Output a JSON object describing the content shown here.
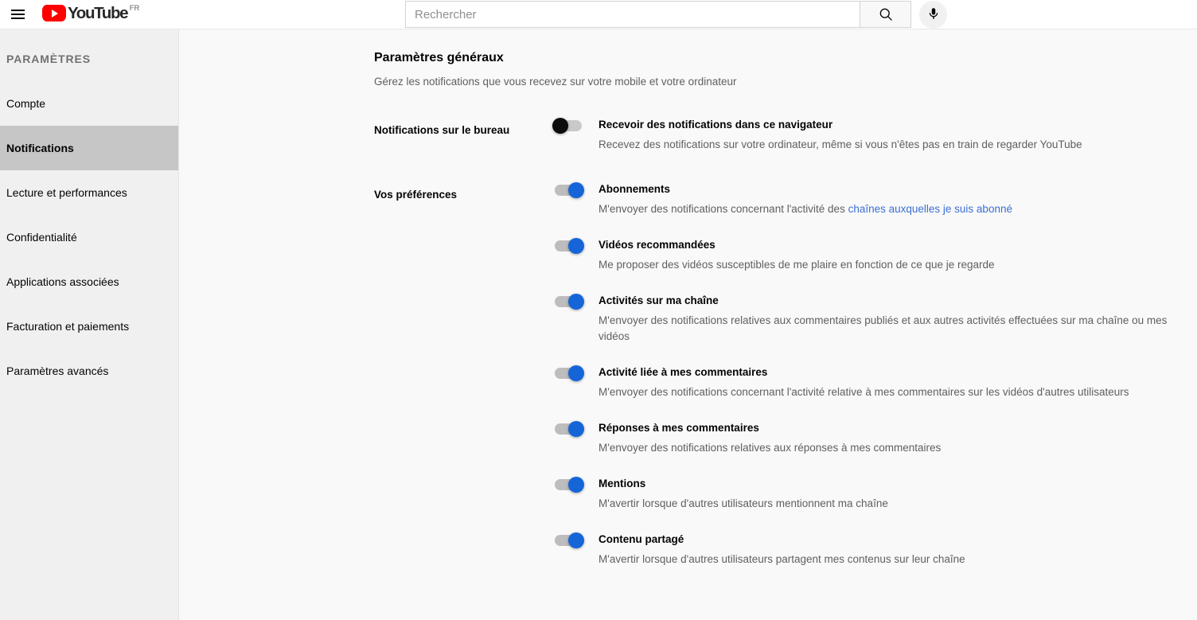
{
  "masthead": {
    "guide_icon": "hamburger-menu-icon",
    "logo_word": "YouTube",
    "logo_country": "FR",
    "logo_icon": "youtube-play-icon",
    "search": {
      "value": "",
      "placeholder": "Rechercher",
      "submit_icon": "search-icon"
    },
    "mic_icon": "microphone-icon",
    "brand_color": "#FF0000"
  },
  "sidebar": {
    "title": "PARAMÈTRES",
    "items": [
      {
        "label": "Compte",
        "active": false
      },
      {
        "label": "Notifications",
        "active": true
      },
      {
        "label": "Lecture et performances",
        "active": false
      },
      {
        "label": "Confidentialité",
        "active": false
      },
      {
        "label": "Applications associées",
        "active": false
      },
      {
        "label": "Facturation et paiements",
        "active": false
      },
      {
        "label": "Paramètres avancés",
        "active": false
      }
    ],
    "active_bg": "#c6c6c6"
  },
  "main": {
    "page_title": "Paramètres généraux",
    "page_subtitle": "Gérez les notifications que vous recevez sur votre mobile et votre ordinateur",
    "sections": [
      {
        "label": "Notifications sur le bureau",
        "rows": [
          {
            "title": "Recevoir des notifications dans ce navigateur",
            "desc": "Recevez des notifications sur votre ordinateur, même si vous n'êtes pas en train de regarder YouTube",
            "state": "off"
          }
        ]
      },
      {
        "label": "Vos préférences",
        "rows": [
          {
            "title": "Abonnements",
            "desc_prefix": "M'envoyer des notifications concernant l'activité des ",
            "desc_link": "chaînes auxquelles je suis abonné",
            "state": "on"
          },
          {
            "title": "Vidéos recommandées",
            "desc": "Me proposer des vidéos susceptibles de me plaire en fonction de ce que je regarde",
            "state": "on"
          },
          {
            "title": "Activités sur ma chaîne",
            "desc": "M'envoyer des notifications relatives aux commentaires publiés et aux autres activités effectuées sur ma chaîne ou mes vidéos",
            "state": "on"
          },
          {
            "title": "Activité liée à mes commentaires",
            "desc": "M'envoyer des notifications concernant l'activité relative à mes commentaires sur les vidéos d'autres utilisateurs",
            "state": "on"
          },
          {
            "title": "Réponses à mes commentaires",
            "desc": "M'envoyer des notifications relatives aux réponses à mes commentaires",
            "state": "on"
          },
          {
            "title": "Mentions",
            "desc": "M'avertir lorsque d'autres utilisateurs mentionnent ma chaîne",
            "state": "on"
          },
          {
            "title": "Contenu partagé",
            "desc": "M'avertir lorsque d'autres utilisateurs partagent mes contenus sur leur chaîne",
            "state": "on"
          }
        ]
      }
    ],
    "link_color": "#3b6fd4",
    "toggle_on_color": "#1565d8",
    "toggle_off_color": "#0d0d0d"
  }
}
